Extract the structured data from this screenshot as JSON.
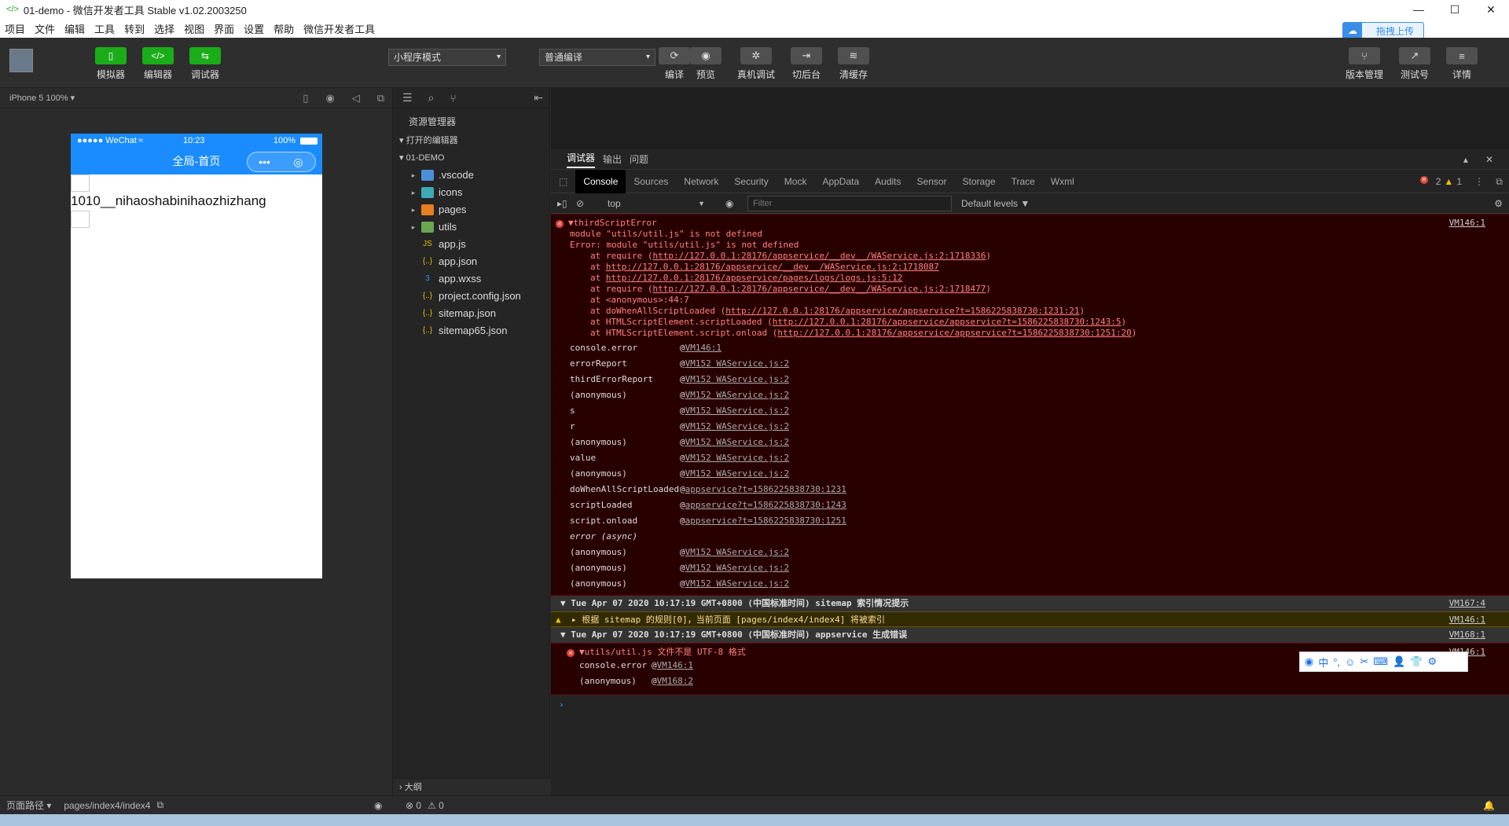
{
  "window": {
    "title": "01-demo - 微信开发者工具 Stable v1.02.2003250",
    "minimize": "—",
    "maximize": "☐",
    "close": "✕"
  },
  "menu": [
    "项目",
    "文件",
    "编辑",
    "工具",
    "转到",
    "选择",
    "视图",
    "界面",
    "设置",
    "帮助",
    "微信开发者工具"
  ],
  "toolbar": {
    "simulator": "模拟器",
    "editor": "编辑器",
    "debugger": "调试器",
    "mode_select": "小程序模式",
    "compile_select": "普通编译",
    "compile": "编译",
    "preview": "预览",
    "remote_debug": "真机调试",
    "background": "切后台",
    "clear_cache": "清缓存",
    "version": "版本管理",
    "test_account": "测试号",
    "details": "详情",
    "upload": "拖拽上传"
  },
  "simulator": {
    "device": "iPhone 5 100% ▾",
    "carrier": "●●●●● WeChat",
    "time": "10:23",
    "battery": "100%",
    "nav_title": "全局-首页",
    "capsule_more": "•••",
    "capsule_close": "◎",
    "content_text": "1010__nihaoshabinihaozhizhang"
  },
  "explorer": {
    "title": "资源管理器",
    "open_editors": "打开的编辑器",
    "project": "01-DEMO",
    "outline": "大纲",
    "folders": [
      {
        "name": ".vscode",
        "color": "#4a90d9"
      },
      {
        "name": "icons",
        "color": "#3fa9b5"
      },
      {
        "name": "pages",
        "color": "#e67e22"
      },
      {
        "name": "utils",
        "color": "#6aa84f"
      }
    ],
    "files": [
      {
        "name": "app.js",
        "icon": "JS",
        "color": "#e8c000"
      },
      {
        "name": "app.json",
        "icon": "{..}",
        "color": "#e8c000"
      },
      {
        "name": "app.wxss",
        "icon": "3",
        "color": "#3f8fe0"
      },
      {
        "name": "project.config.json",
        "icon": "{..}",
        "color": "#e8c000"
      },
      {
        "name": "sitemap.json",
        "icon": "{..}",
        "color": "#e8c000"
      },
      {
        "name": "sitemap65.json",
        "icon": "{..}",
        "color": "#e8c000"
      }
    ]
  },
  "devtools": {
    "tabs": [
      "调试器",
      "输出",
      "问题"
    ],
    "panels": [
      "Console",
      "Sources",
      "Network",
      "Security",
      "Mock",
      "AppData",
      "Audits",
      "Sensor",
      "Storage",
      "Trace",
      "Wxml"
    ],
    "errors": "2",
    "warnings": "1",
    "context": "top",
    "filter_placeholder": "Filter",
    "levels": "Default levels ▼"
  },
  "console": {
    "error1": {
      "title": "▼thirdScriptError",
      "link": "VM146:1",
      "lines": [
        "module \"utils/util.js\" is not defined",
        "Error: module \"utils/util.js\" is not defined"
      ],
      "at_lines": [
        [
          "at require (",
          "http://127.0.0.1:28176/appservice/__dev__/WAService.js:2:1718336",
          ")"
        ],
        [
          "at ",
          "http://127.0.0.1:28176/appservice/__dev__/WAService.js:2:1718087",
          ""
        ],
        [
          "at ",
          "http://127.0.0.1:28176/appservice/pages/logs/logs.js:5:12",
          ""
        ],
        [
          "at require (",
          "http://127.0.0.1:28176/appservice/__dev__/WAService.js:2:1718477",
          ")"
        ],
        [
          "at <anonymous>:44:7",
          "",
          ""
        ],
        [
          "at doWhenAllScriptLoaded (",
          "http://127.0.0.1:28176/appservice/appservice?t=1586225838730:1231:21",
          ")"
        ],
        [
          "at HTMLScriptElement.scriptLoaded (",
          "http://127.0.0.1:28176/appservice/appservice?t=1586225838730:1243:5",
          ")"
        ],
        [
          "at HTMLScriptElement.script.onload (",
          "http://127.0.0.1:28176/appservice/appservice?t=1586225838730:1251:20",
          ")"
        ]
      ],
      "stack": [
        [
          "console.error",
          "VM146:1"
        ],
        [
          "errorReport",
          "VM152 WAService.js:2"
        ],
        [
          "thirdErrorReport",
          "VM152 WAService.js:2"
        ],
        [
          "(anonymous)",
          "VM152 WAService.js:2"
        ],
        [
          "s",
          "VM152 WAService.js:2"
        ],
        [
          "r",
          "VM152 WAService.js:2"
        ],
        [
          "(anonymous)",
          "VM152 WAService.js:2"
        ],
        [
          "value",
          "VM152 WAService.js:2"
        ],
        [
          "(anonymous)",
          "VM152 WAService.js:2"
        ],
        [
          "doWhenAllScriptLoaded",
          "appservice?t=1586225838730:1231"
        ],
        [
          "scriptLoaded",
          "appservice?t=1586225838730:1243"
        ],
        [
          "script.onload",
          "appservice?t=1586225838730:1251"
        ],
        [
          "error (async)",
          ""
        ],
        [
          "(anonymous)",
          "VM152 WAService.js:2"
        ],
        [
          "(anonymous)",
          "VM152 WAService.js:2"
        ],
        [
          "(anonymous)",
          "VM152 WAService.js:2"
        ]
      ]
    },
    "group1": {
      "title": "▼ Tue Apr 07 2020 10:17:19 GMT+0800 (中国标准时间) sitemap 索引情况提示",
      "link": "VM167:4"
    },
    "warn1": {
      "text": "▸ 根据 sitemap 的规则[0]，当前页面 [pages/index4/index4] 将被索引",
      "link": "VM146:1"
    },
    "group2": {
      "title": "▼ Tue Apr 07 2020 10:17:19 GMT+0800 (中国标准时间) appservice 生成错误",
      "link": "VM168:1"
    },
    "error2": {
      "title": "▼utils/util.js 文件不是 UTF-8 格式",
      "link": "VM146:1",
      "stack": [
        [
          "console.error",
          "VM146:1"
        ],
        [
          "(anonymous)",
          "VM168:2"
        ]
      ]
    },
    "prompt": "›"
  },
  "statusbar": {
    "path_label": "页面路径 ▾",
    "path": "pages/index4/index4",
    "errors": "⊗ 0",
    "warnings": "⚠ 0"
  }
}
